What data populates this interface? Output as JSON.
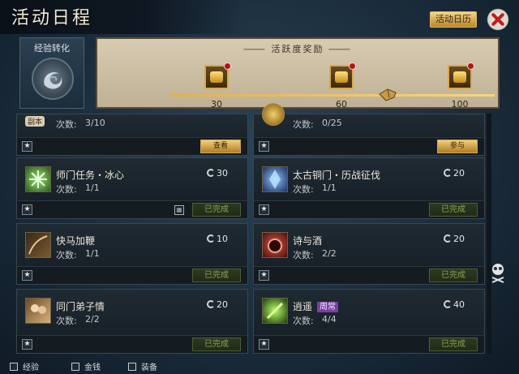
{
  "header": {
    "title": "活动日程",
    "calendar_button": "活动日历",
    "close_icon": "close-icon"
  },
  "exp_panel": {
    "label": "经验转化",
    "emblem_icon": "swirl-emblem-icon"
  },
  "reward_panel": {
    "title": "活跃度奖励",
    "milestones": [
      {
        "value": "30",
        "icon": "gold-chest-icon"
      },
      {
        "value": "60",
        "icon": "gold-chest-icon"
      },
      {
        "value": "100",
        "icon": "gold-chest-icon"
      }
    ],
    "current_marker_icon": "pointer-hand-icon"
  },
  "count_label": "次数:",
  "activities": [
    {
      "name": "",
      "tag_top": "副本",
      "count": "3/10",
      "points": "",
      "button": "查看",
      "status": "button",
      "icon": "dungeon-icon"
    },
    {
      "name": "",
      "count": "0/25",
      "points": "",
      "button": "参与",
      "status": "button",
      "icon": "gold-icon"
    },
    {
      "name": "师门任务・冰心",
      "count": "1/1",
      "points": "30",
      "button": "已完成",
      "status": "done",
      "icon": "snowflake-icon",
      "calendar_icon": "calendar-icon"
    },
    {
      "name": "太古铜门・历战征伐",
      "count": "1/1",
      "points": "20",
      "button": "已完成",
      "status": "done",
      "icon": "blue-crystal-icon"
    },
    {
      "name": "快马加鞭",
      "count": "1/1",
      "points": "10",
      "button": "已完成",
      "status": "done",
      "icon": "whip-icon"
    },
    {
      "name": "诗与酒",
      "count": "2/2",
      "points": "20",
      "button": "已完成",
      "status": "done",
      "icon": "wine-icon"
    },
    {
      "name": "同门弟子情",
      "count": "2/2",
      "points": "20",
      "button": "已完成",
      "status": "done",
      "icon": "disciples-icon"
    },
    {
      "name": "逍遥",
      "tag": "周常",
      "count": "4/4",
      "points": "40",
      "button": "已完成",
      "status": "done",
      "icon": "green-spirit-icon"
    }
  ],
  "filters": [
    {
      "label": "经验"
    },
    {
      "label": "金钱"
    },
    {
      "label": "装备"
    }
  ],
  "side_icon": "skull-icon",
  "colors": {
    "gold": "#e0b860",
    "done_text": "#8ea05e",
    "weekly_tag": "#7b3fa0"
  }
}
